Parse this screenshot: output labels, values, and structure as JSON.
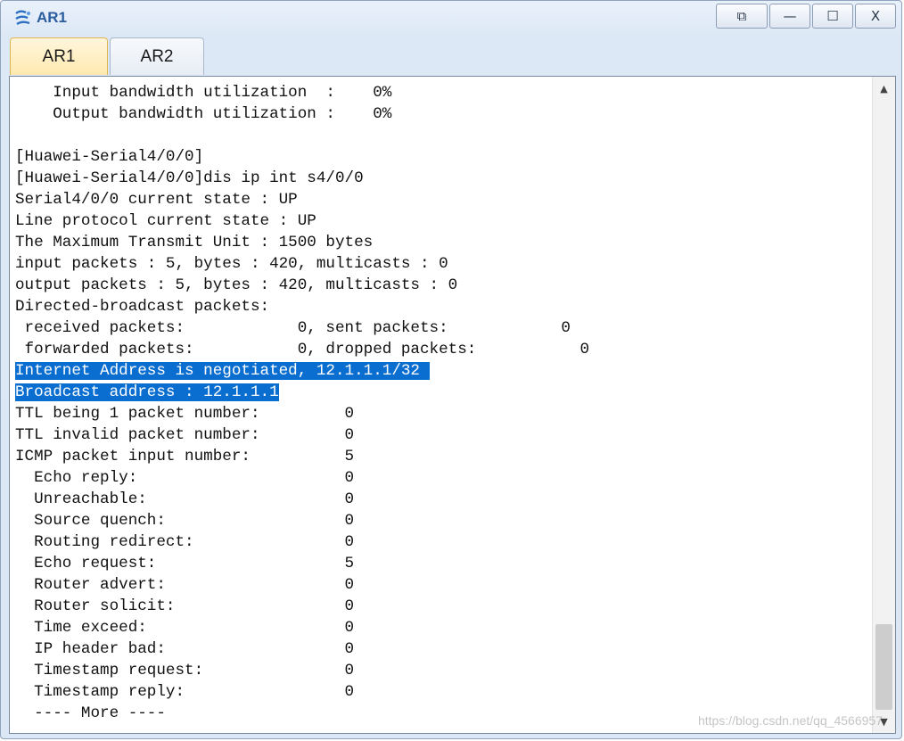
{
  "window": {
    "title": "AR1",
    "icon": "router-app-icon",
    "controls": {
      "restore_glyph": "⧉",
      "minimize_glyph": "—",
      "maximize_glyph": "☐",
      "close_glyph": "X"
    }
  },
  "tabs": [
    {
      "label": "AR1",
      "active": true
    },
    {
      "label": "AR2",
      "active": false
    }
  ],
  "terminal": {
    "lines": [
      "    Input bandwidth utilization  :    0%",
      "    Output bandwidth utilization :    0%",
      "",
      "[Huawei-Serial4/0/0]",
      "[Huawei-Serial4/0/0]dis ip int s4/0/0",
      "Serial4/0/0 current state : UP",
      "Line protocol current state : UP",
      "The Maximum Transmit Unit : 1500 bytes",
      "input packets : 5, bytes : 420, multicasts : 0",
      "output packets : 5, bytes : 420, multicasts : 0",
      "Directed-broadcast packets:",
      " received packets:            0, sent packets:            0",
      " forwarded packets:           0, dropped packets:           0",
      "Internet Address is negotiated, 12.1.1.1/32 ",
      "Broadcast address : 12.1.1.1",
      "TTL being 1 packet number:         0",
      "TTL invalid packet number:         0",
      "ICMP packet input number:          5",
      "  Echo reply:                      0",
      "  Unreachable:                     0",
      "  Source quench:                   0",
      "  Routing redirect:                0",
      "  Echo request:                    5",
      "  Router advert:                   0",
      "  Router solicit:                  0",
      "  Time exceed:                     0",
      "  IP header bad:                   0",
      "  Timestamp request:               0",
      "  Timestamp reply:                 0",
      "  ---- More ----"
    ],
    "highlighted_line_indices": [
      13,
      14
    ],
    "highlight_color": "#0a6ed1"
  },
  "scrollbar": {
    "up_glyph": "▲",
    "down_glyph": "▼"
  },
  "watermark": "https://blog.csdn.net/qq_4566957"
}
